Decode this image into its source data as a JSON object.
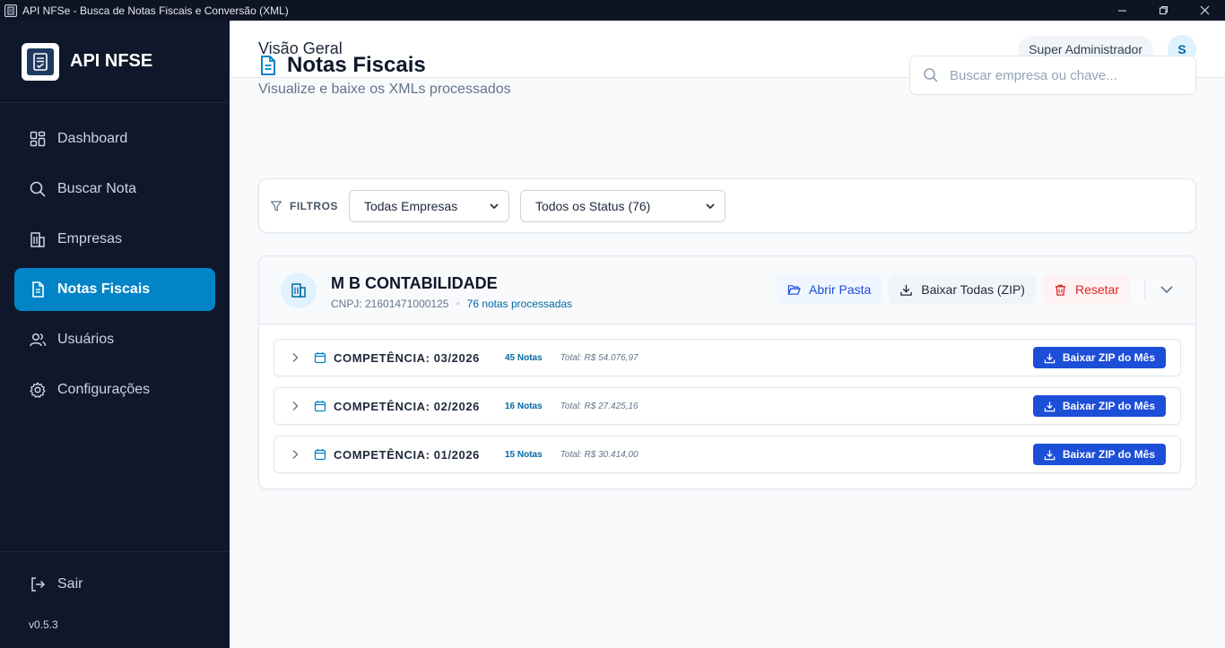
{
  "window": {
    "title": "API NFSe - Busca de Notas Fiscais e Conversão (XML)"
  },
  "sidebar": {
    "brand": "API NFSE",
    "items": [
      {
        "label": "Dashboard",
        "icon": "grid-icon",
        "active": false
      },
      {
        "label": "Buscar Nota",
        "icon": "search-icon",
        "active": false
      },
      {
        "label": "Empresas",
        "icon": "building-icon",
        "active": false
      },
      {
        "label": "Notas Fiscais",
        "icon": "file-text-icon",
        "active": true
      },
      {
        "label": "Usuários",
        "icon": "users-icon",
        "active": false
      },
      {
        "label": "Configurações",
        "icon": "gear-icon",
        "active": false
      }
    ],
    "logout": "Sair",
    "version": "v0.5.3"
  },
  "topbar": {
    "title": "Visão Geral",
    "user_role": "Super Administrador",
    "avatar_initial": "S"
  },
  "page": {
    "title": "Notas Fiscais",
    "subtitle": "Visualize e baixe os XMLs processados",
    "search_placeholder": "Buscar empresa ou chave..."
  },
  "filters": {
    "label": "FILTROS",
    "company_select": "Todas Empresas",
    "status_select": "Todos os Status (76)"
  },
  "company": {
    "name": "M B CONTABILIDADE",
    "cnpj": "CNPJ: 21601471000125",
    "notes_processed": "76 notas processadas",
    "open_folder": "Abrir Pasta",
    "download_all": "Baixar Todas (ZIP)",
    "reset": "Resetar"
  },
  "months": [
    {
      "label": "COMPETÊNCIA: 03/2026",
      "count": "45 Notas",
      "total": "Total: R$ 54.076,97",
      "button": "Baixar ZIP do Mês"
    },
    {
      "label": "COMPETÊNCIA: 02/2026",
      "count": "16 Notas",
      "total": "Total: R$ 27.425,16",
      "button": "Baixar ZIP do Mês"
    },
    {
      "label": "COMPETÊNCIA: 01/2026",
      "count": "15 Notas",
      "total": "Total: R$ 30.414,00",
      "button": "Baixar ZIP do Mês"
    }
  ],
  "colors": {
    "sidebar_bg": "#0f172a",
    "active_nav": "#0284c7",
    "primary_button": "#1d4ed8",
    "danger": "#dc2626"
  }
}
